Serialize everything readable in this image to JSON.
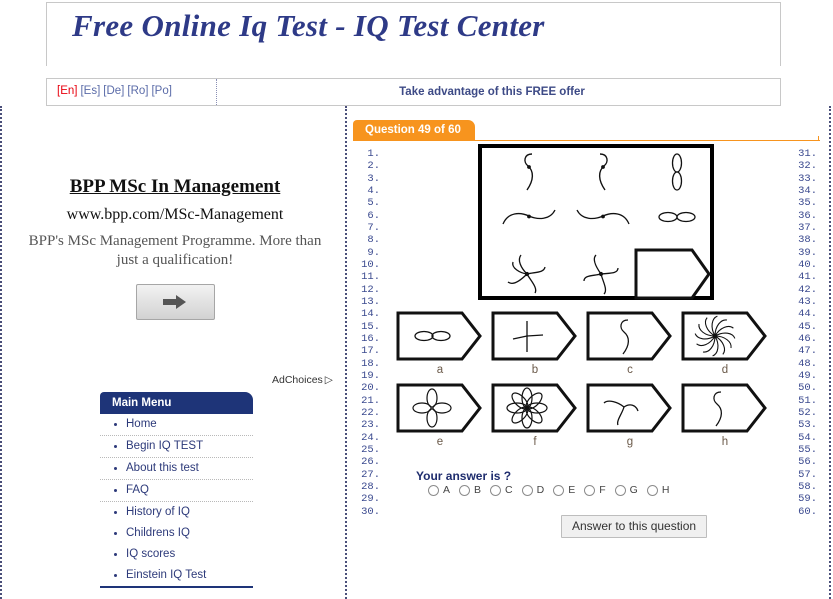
{
  "header": {
    "site_title": "Free Online Iq Test - IQ Test Center",
    "languages": [
      {
        "label": "[En]",
        "active": true
      },
      {
        "label": "[Es]",
        "active": false
      },
      {
        "label": "[De]",
        "active": false
      },
      {
        "label": "[Ro]",
        "active": false
      },
      {
        "label": "[Po]",
        "active": false
      }
    ],
    "offer_text": "Take advantage of this FREE offer"
  },
  "ad": {
    "title": "BPP MSc In Management",
    "url": "www.bpp.com/MSc-Management",
    "description": "BPP's MSc Management Programme. More than just a qualification!",
    "button_icon": "arrow-right-icon",
    "adchoices_label": "AdChoices"
  },
  "menu": {
    "header": "Main Menu",
    "items": [
      {
        "label": "Home"
      },
      {
        "label": "Begin IQ TEST"
      },
      {
        "label": "About this test"
      },
      {
        "label": "FAQ"
      },
      {
        "label": "History of IQ"
      },
      {
        "label": "Childrens IQ"
      },
      {
        "label": "IQ scores"
      },
      {
        "label": "Einstein IQ Test"
      }
    ]
  },
  "question": {
    "tab_label": "Question 49 of 60",
    "current": 49,
    "total": 60,
    "numbers_left": [
      "1.",
      "2.",
      "3.",
      "4.",
      "5.",
      "6.",
      "7.",
      "8.",
      "9.",
      "10.",
      "11.",
      "12.",
      "13.",
      "14.",
      "15.",
      "16.",
      "17.",
      "18.",
      "19.",
      "20.",
      "21.",
      "22.",
      "23.",
      "24.",
      "25.",
      "26.",
      "27.",
      "28.",
      "29.",
      "30."
    ],
    "numbers_right": [
      "31.",
      "32.",
      "33.",
      "34.",
      "35.",
      "36.",
      "37.",
      "38.",
      "39.",
      "40.",
      "41.",
      "42.",
      "43.",
      "44.",
      "45.",
      "46.",
      "47.",
      "48.",
      "49.",
      "50.",
      "51.",
      "52.",
      "53.",
      "54.",
      "55.",
      "56.",
      "57.",
      "58.",
      "59.",
      "60."
    ],
    "matrix": [
      {
        "cell": "r1c1",
        "shape": "s-curve-single"
      },
      {
        "cell": "r1c2",
        "shape": "s-curve-mirrored"
      },
      {
        "cell": "r1c3",
        "shape": "vertical-double-loop"
      },
      {
        "cell": "r2c1",
        "shape": "horizontal-wave"
      },
      {
        "cell": "r2c2",
        "shape": "horizontal-wave-mirrored"
      },
      {
        "cell": "r2c3",
        "shape": "horizontal-double-loop"
      },
      {
        "cell": "r3c1",
        "shape": "five-arm-pinwheel"
      },
      {
        "cell": "r3c2",
        "shape": "four-arm-pinwheel"
      },
      {
        "cell": "r3c3",
        "shape": "missing-answer-tile"
      }
    ],
    "options": [
      {
        "letter": "a",
        "shape": "horizontal-double-loop"
      },
      {
        "letter": "b",
        "shape": "cross-four-arms"
      },
      {
        "letter": "c",
        "shape": "s-curve-single"
      },
      {
        "letter": "d",
        "shape": "many-arm-spiral"
      },
      {
        "letter": "e",
        "shape": "four-petal-flower"
      },
      {
        "letter": "f",
        "shape": "eight-petal-flower"
      },
      {
        "letter": "g",
        "shape": "three-arm-pinwheel"
      },
      {
        "letter": "h",
        "shape": "s-curve-single-thin"
      }
    ],
    "answer_prompt": "Your answer is ?",
    "answer_choices": [
      "A",
      "B",
      "C",
      "D",
      "E",
      "F",
      "G",
      "H"
    ],
    "selected_answer": null,
    "submit_label": "Answer to this question"
  },
  "colors": {
    "title": "#2e3a87",
    "accent_orange": "#f7941e",
    "menu_blue": "#1e3478",
    "active_lang": "#e8000d",
    "link_blue": "#2d3a7a"
  }
}
